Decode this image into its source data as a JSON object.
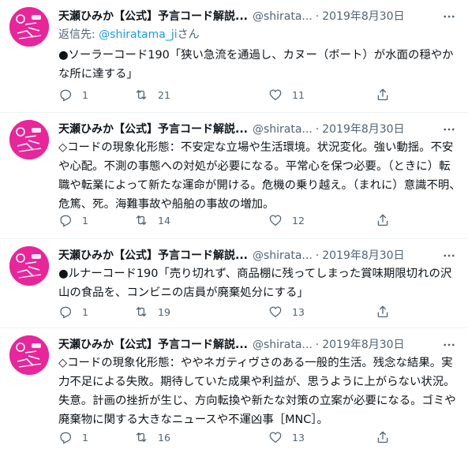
{
  "tweets": [
    {
      "name": "天瀬ひみか【公式】予言コード解説...",
      "handle": "@shirata...",
      "separator": "·",
      "date": "2019年8月30日",
      "reply_prefix": "返信先: ",
      "reply_handle": "@shiratama_ji",
      "reply_suffix": "さん",
      "text": "●ソーラーコード190「狭い急流を通過し、カヌー（ボート）が水面の穏やかな所に達する」",
      "replies": "1",
      "retweets": "21",
      "likes": "11"
    },
    {
      "name": "天瀬ひみか【公式】予言コード解説...",
      "handle": "@shirata...",
      "separator": "·",
      "date": "2019年8月30日",
      "text": "◇コードの現象化形態：不安定な立場や生活環境。状況変化。強い動揺。不安や心配。不測の事態への対処が必要になる。平常心を保つ必要。（ときに）転職や転業によって新たな運命が開ける。危機の乗り越え。（まれに）意識不明、危篤、死。海難事故や船舶の事故の増加。",
      "replies": "1",
      "retweets": "14",
      "likes": "12"
    },
    {
      "name": "天瀬ひみか【公式】予言コード解説...",
      "handle": "@shirata...",
      "separator": "·",
      "date": "2019年8月30日",
      "text": "●ルナーコード190「売り切れず、商品棚に残ってしまった賞味期限切れの沢山の食品を、コンビニの店員が廃棄処分にする」",
      "replies": "1",
      "retweets": "19",
      "likes": "13"
    },
    {
      "name": "天瀬ひみか【公式】予言コード解説...",
      "handle": "@shirata...",
      "separator": "·",
      "date": "2019年8月30日",
      "text": "◇コードの現象化形態：ややネガティヴさのある一般的生活。残念な結果。実力不足による失敗。期待していた成果や利益が、思うように上がらない状況。失意。計画の挫折が生じ、方向転換や新たな対策の立案が必要になる。ゴミや廃棄物に関する大きなニュースや不運凶事［MNC］。",
      "replies": "1",
      "retweets": "16",
      "likes": "13"
    }
  ],
  "icons": {
    "reply": "reply-icon",
    "retweet": "retweet-icon",
    "like": "heart-icon",
    "share": "share-icon",
    "more": "more-icon"
  },
  "colors": {
    "text": "#0f1419",
    "secondary": "#536471",
    "link": "#1d9bf0",
    "avatar": "#e8269a"
  }
}
